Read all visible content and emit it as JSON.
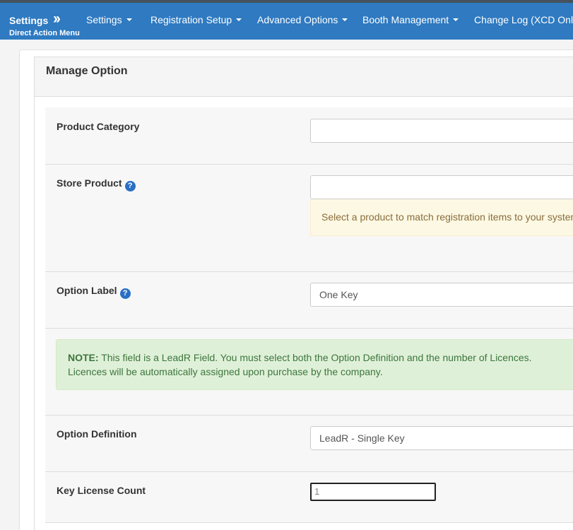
{
  "navbar": {
    "brand": "Settings",
    "brand_sub": "Direct Action Menu",
    "items": [
      {
        "label": "Settings"
      },
      {
        "label": "Registration Setup"
      },
      {
        "label": "Advanced Options"
      },
      {
        "label": "Booth Management"
      },
      {
        "label": "Change Log (XCD Only"
      }
    ]
  },
  "panel": {
    "title": "Manage Option"
  },
  "form": {
    "product_category": {
      "label": "Product Category",
      "value": ""
    },
    "store_product": {
      "label": "Store Product",
      "value": "",
      "help_text": "Select a product to match registration items to your system"
    },
    "option_label": {
      "label": "Option Label",
      "value": "One Key"
    },
    "note": {
      "prefix": "NOTE:",
      "text": " This field is a LeadR Field. You must select both the Option Definition and the number of Licences.",
      "text2": "Licences will be automatically assigned upon purchase by the company."
    },
    "option_definition": {
      "label": "Option Definition",
      "value": "LeadR - Single Key"
    },
    "key_license_count": {
      "label": "Key License Count",
      "value": "1"
    }
  },
  "colors": {
    "navbar": "#2f7ac1",
    "help_icon": "#2a6fc5",
    "note_bg": "#dff0d8",
    "help_bg": "#fcf8e3"
  },
  "icons": {
    "brand_chevron": "double-chevron-right-icon",
    "help": "question-circle-icon",
    "dropdown": "caret-down-icon"
  }
}
